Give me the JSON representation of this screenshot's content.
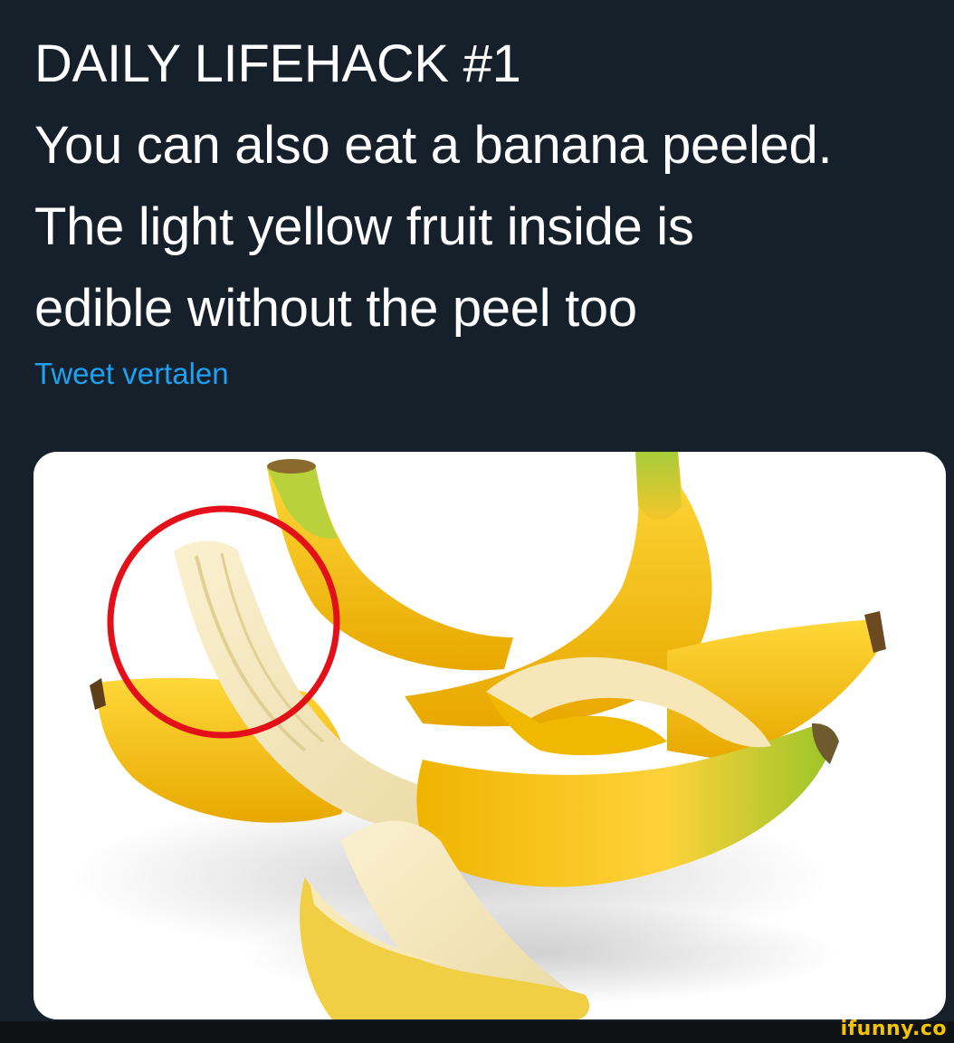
{
  "tweet": {
    "lines": [
      "DAILY LIFEHACK #1",
      "You can also eat a banana peeled.",
      "The light yellow fruit inside is",
      "edible without the peel too"
    ],
    "translate_label": "Tweet vertalen"
  },
  "media": {
    "subject": "bananas-photo",
    "highlight": "red-circle"
  },
  "watermark": "ifunny.co",
  "colors": {
    "background": "#15202b",
    "text": "#ffffff",
    "link": "#1da1f2",
    "highlight_circle": "#e3101a",
    "watermark": "#f5c400"
  }
}
